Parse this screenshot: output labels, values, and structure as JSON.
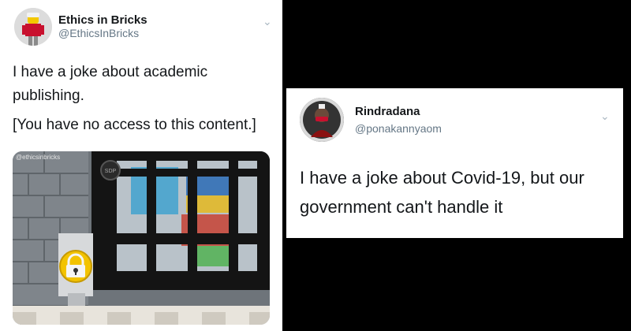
{
  "left_tweet": {
    "display_name": "Ethics in Bricks",
    "handle": "@EthicsInBricks",
    "text_line1": "I have a joke about academic",
    "text_line2": "publishing.",
    "text_line3": "[You have no access to this content.]",
    "media_watermark": "@ethicsinbricks",
    "media_badge": "SDP",
    "avatar_icon": "lego-minifigure-icon",
    "media_description": "lego-jail-cell-with-padlock"
  },
  "right_tweet": {
    "display_name": "Rindradana",
    "handle": "@ponakannyaom",
    "text_line1": "I have a joke about Covid-19, but our",
    "text_line2": "government can't handle it",
    "avatar_icon": "masked-person-avatar-icon"
  },
  "colors": {
    "background": "#000000",
    "card": "#ffffff",
    "text_primary": "#14171a",
    "text_secondary": "#657786",
    "chevron": "#aab8c2"
  }
}
